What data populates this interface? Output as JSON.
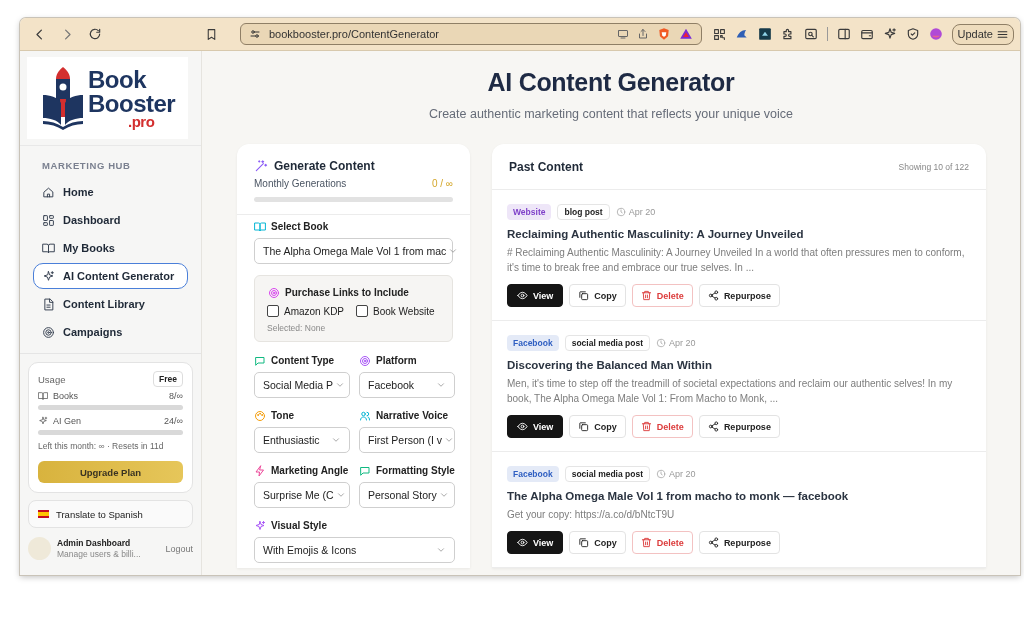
{
  "browser": {
    "url": "bookbooster.pro/ContentGenerator",
    "update_button": "Update"
  },
  "sidebar": {
    "logo": {
      "line1": "Book",
      "line2": "Booster",
      "suffix": ".pro"
    },
    "section_title": "MARKETING HUB",
    "items": [
      {
        "label": "Home",
        "selected": false
      },
      {
        "label": "Dashboard",
        "selected": false
      },
      {
        "label": "My Books",
        "selected": false
      },
      {
        "label": "AI Content Generator",
        "selected": true
      },
      {
        "label": "Content Library",
        "selected": false
      },
      {
        "label": "Campaigns",
        "selected": false
      }
    ],
    "usage": {
      "title": "Usage",
      "plan": "Free",
      "meters": [
        {
          "label": "Books",
          "reading": "8/∞",
          "level": 0
        },
        {
          "label": "AI Gen",
          "reading": "24/∞",
          "level": 0
        }
      ],
      "note": "Left this month: ∞ · Resets in 11d",
      "button": "Upgrade Plan"
    },
    "translate_button": "Translate to Spanish",
    "user": {
      "name": "Admin Dashboard",
      "subtitle": "Manage users & billi...",
      "logout": "Logout"
    }
  },
  "header": {
    "title": "AI Content Generator",
    "subtitle": "Create authentic marketing content that reflects your unique voice"
  },
  "generate": {
    "title": "Generate Content",
    "quota_label": "Monthly Generations",
    "quota": "0 / ∞",
    "level": 0,
    "book": {
      "label": "Select Book",
      "value": "The Alpha Omega Male Vol 1 from mac"
    },
    "purchase_links": {
      "title": "Purchase Links to Include",
      "options": [
        {
          "label": "Amazon KDP",
          "checked": false
        },
        {
          "label": "Book Website",
          "checked": false
        }
      ],
      "summary": "Selected: None"
    },
    "fields": [
      {
        "label": "Content Type",
        "value": "Social Media P"
      },
      {
        "label": "Platform",
        "value": "Facebook"
      },
      {
        "label": "Tone",
        "value": "Enthusiastic"
      },
      {
        "label": "Narrative Voice",
        "value": "First Person (I v"
      },
      {
        "label": "Marketing Angle",
        "value": "Surprise Me (C"
      },
      {
        "label": "Formatting Style",
        "value": "Personal Story"
      },
      {
        "label": "Visual Style",
        "value": "With Emojis & Icons"
      }
    ]
  },
  "past_content": {
    "title": "Past Content",
    "count": "Showing 10 of 122",
    "items": [
      {
        "platform": "Website",
        "color": "#7e3fc9",
        "type": "blog post",
        "date": "Apr 20",
        "title": "Reclaiming Authentic Masculinity: A Journey Unveiled",
        "excerpt": "# Reclaiming Authentic Masculinity: A Journey Unveiled In a world that often pressures men to conform, it's time to break free and embrace our true selves. In ...",
        "actions": [
          {
            "label": "View",
            "kind": "primary"
          },
          {
            "label": "Copy",
            "kind": "plain"
          },
          {
            "label": "Delete",
            "kind": "danger"
          },
          {
            "label": "Repurpose",
            "kind": "share"
          }
        ]
      },
      {
        "platform": "Facebook",
        "color": "#2f5fc2",
        "type": "social media post",
        "date": "Apr 20",
        "title": "Discovering the Balanced Man Within",
        "excerpt": "Men, it's time to step off the treadmill of societal expectations and reclaim our authentic selves! In my book, The Alpha Omega Male Vol 1: From Macho to Monk, ...",
        "actions": [
          {
            "label": "View",
            "kind": "primary"
          },
          {
            "label": "Copy",
            "kind": "plain"
          },
          {
            "label": "Delete",
            "kind": "danger"
          },
          {
            "label": "Repurpose",
            "kind": "share"
          }
        ]
      },
      {
        "platform": "Facebook",
        "color": "#2f5fc2",
        "type": "social media post",
        "date": "Apr 20",
        "title": "The Alpha Omega Male Vol 1 from macho to monk — facebook",
        "excerpt": "Get your copy: https://a.co/d/bNtcT9U",
        "actions": [
          {
            "label": "View",
            "kind": "primary"
          },
          {
            "label": "Copy",
            "kind": "plain"
          },
          {
            "label": "Delete",
            "kind": "danger"
          },
          {
            "label": "Repurpose",
            "kind": "share"
          }
        ]
      }
    ]
  }
}
